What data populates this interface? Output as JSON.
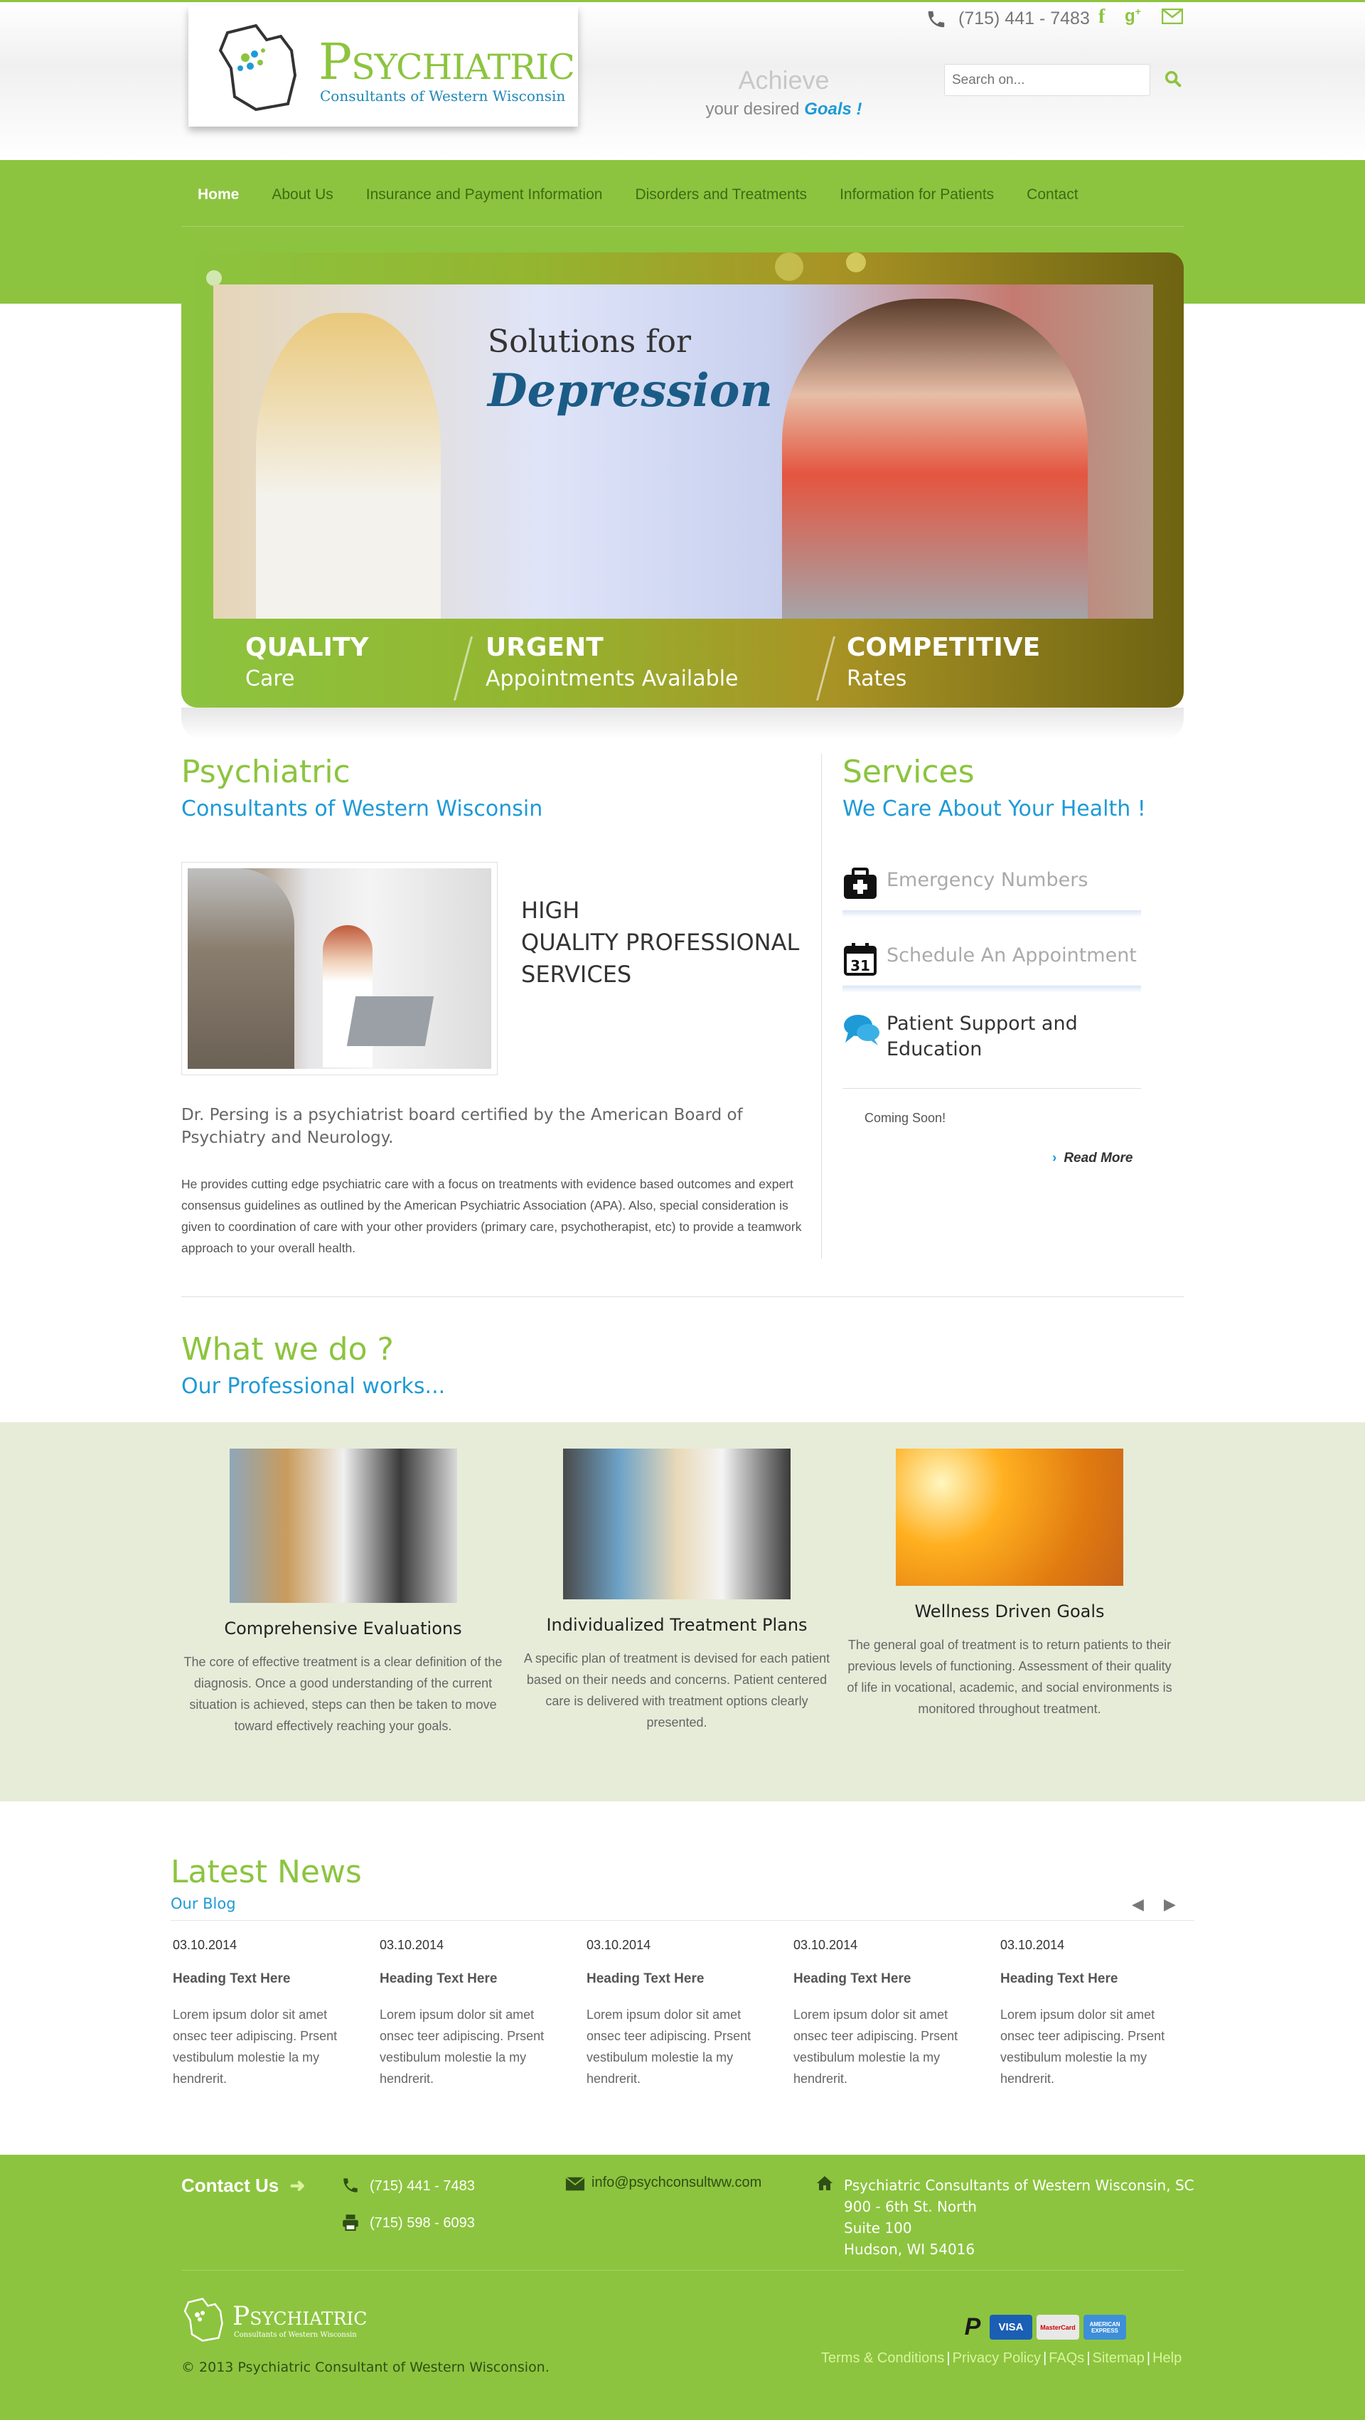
{
  "header": {
    "logo_title": "Psychiatric",
    "logo_subtitle": "Consultants of Western Wisconsin",
    "tagline_1": "Achieve",
    "tagline_2_prefix": "your desired",
    "tagline_2_emph": "Goals !",
    "phone": "(715) 441 - 7483",
    "search_placeholder": "Search on..."
  },
  "nav": {
    "items": [
      {
        "label": "Home",
        "active": true
      },
      {
        "label": "About Us"
      },
      {
        "label": "Insurance and Payment Information"
      },
      {
        "label": "Disorders and Treatments"
      },
      {
        "label": "Information for Patients"
      },
      {
        "label": "Contact"
      }
    ]
  },
  "slider": {
    "line1": "Solutions for",
    "line2": "Depression",
    "features": [
      {
        "title": "QUALITY",
        "sub": "Care"
      },
      {
        "title": "URGENT",
        "sub": "Appointments Available"
      },
      {
        "title": "COMPETITIVE",
        "sub": "Rates"
      }
    ]
  },
  "intro": {
    "title": "Psychiatric",
    "subtitle": "Consultants of Western Wisconsin",
    "hq_lines": [
      "HIGH",
      "QUALITY PROFESSIONAL",
      "SERVICES"
    ],
    "lead": "Dr. Persing is a psychiatrist board certified by the American Board of Psychiatry and Neurology.",
    "body": "He provides cutting edge psychiatric care with a focus on treatments with evidence based outcomes and expert consensus guidelines as outlined by the American Psychiatric Association (APA). Also, special consideration is given to coordination of care with your other providers (primary care, psychotherapist, etc) to provide a teamwork approach to your overall health."
  },
  "services": {
    "title": "Services",
    "subtitle": "We Care About Your Health !",
    "items": [
      {
        "label": "Emergency Numbers",
        "icon": "first-aid-kit-icon"
      },
      {
        "label": "Schedule An Appointment",
        "icon": "calendar-icon",
        "icon_text": "31"
      },
      {
        "label": "Patient Support and Education",
        "icon": "chat-bubbles-icon"
      }
    ],
    "expanded_text": "Coming Soon!",
    "read_more": "Read More"
  },
  "what_we_do": {
    "title": "What we do ?",
    "subtitle": "Our Professional works...",
    "cards": [
      {
        "title": "Comprehensive Evaluations",
        "text": "The core of effective treatment is a clear definition of the diagnosis. Once a good understanding of the current situation is achieved, steps can then be taken to move toward effectively reaching your goals."
      },
      {
        "title": "Individualized Treatment Plans",
        "text": "A specific plan of treatment is devised for each patient based on their needs and concerns. Patient centered care is delivered with treatment options clearly presented."
      },
      {
        "title": "Wellness Driven Goals",
        "text": "The general goal of treatment is to return patients to their previous levels of functioning. Assessment of their quality of life in vocational, academic, and social environments is monitored throughout treatment."
      }
    ]
  },
  "news": {
    "title": "Latest News",
    "subtitle": "Our Blog",
    "items": [
      {
        "date": "03.10.2014",
        "heading": "Heading Text Here",
        "text": "Lorem ipsum dolor sit amet onsec teer adipiscing. Prsent vestibulum molestie la my hendrerit."
      },
      {
        "date": "03.10.2014",
        "heading": "Heading Text Here",
        "text": "Lorem ipsum dolor sit amet onsec teer adipiscing. Prsent vestibulum molestie la my hendrerit."
      },
      {
        "date": "03.10.2014",
        "heading": "Heading Text Here",
        "text": "Lorem ipsum dolor sit amet onsec teer adipiscing. Prsent vestibulum molestie la my hendrerit."
      },
      {
        "date": "03.10.2014",
        "heading": "Heading Text Here",
        "text": "Lorem ipsum dolor sit amet onsec teer adipiscing. Prsent vestibulum molestie la my hendrerit."
      },
      {
        "date": "03.10.2014",
        "heading": "Heading Text Here",
        "text": "Lorem ipsum dolor sit amet onsec teer adipiscing. Prsent vestibulum molestie la my hendrerit."
      }
    ]
  },
  "footer": {
    "contact_label": "Contact Us",
    "phone": "(715) 441 - 7483",
    "fax": "(715) 598 - 6093",
    "email": "info@psychconsultww.com",
    "address": [
      "Psychiatric Consultants of Western Wisconsin, SC",
      "900 - 6th St. North",
      "Suite 100",
      "Hudson, WI 54016"
    ],
    "logo_title": "Psychiatric",
    "logo_subtitle": "Consultants of Western Wisconsin",
    "copyright": "© 2013 Psychiatric Consultant of Western Wisconsion.",
    "links": [
      "Terms & Conditions",
      "Privacy Policy",
      "FAQs",
      "Sitemap",
      "Help"
    ],
    "payment_cards": [
      "P",
      "VISA",
      "MasterCard",
      "AMERICAN EXPRESS"
    ]
  },
  "colors": {
    "brand_green": "#8cc43f",
    "accent_blue": "#1e9ad6"
  }
}
